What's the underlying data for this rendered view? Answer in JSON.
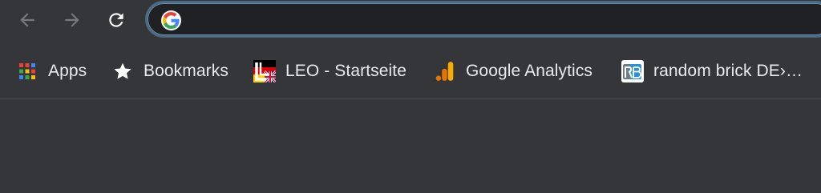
{
  "toolbar": {
    "back": {
      "icon": "back-arrow-icon"
    },
    "forward": {
      "icon": "forward-arrow-icon"
    },
    "reload": {
      "icon": "reload-icon"
    },
    "omnibox": {
      "icon": "google-icon",
      "value": "",
      "placeholder": ""
    }
  },
  "bookmarks": {
    "items": [
      {
        "label": "Apps",
        "icon": "apps-grid-icon"
      },
      {
        "label": "Bookmarks",
        "icon": "star-icon"
      },
      {
        "label": "LEO - Startseite",
        "icon": "leo-favicon-icon"
      },
      {
        "label": "Google Analytics",
        "icon": "analytics-icon"
      },
      {
        "label": "random brick DE›…",
        "icon": "random-brick-favicon-icon"
      }
    ]
  },
  "colors": {
    "background": "#35363a",
    "omnibox_border": "#4a6b85",
    "text": "#e8eaed",
    "analytics_orange": "#f9ab00"
  }
}
